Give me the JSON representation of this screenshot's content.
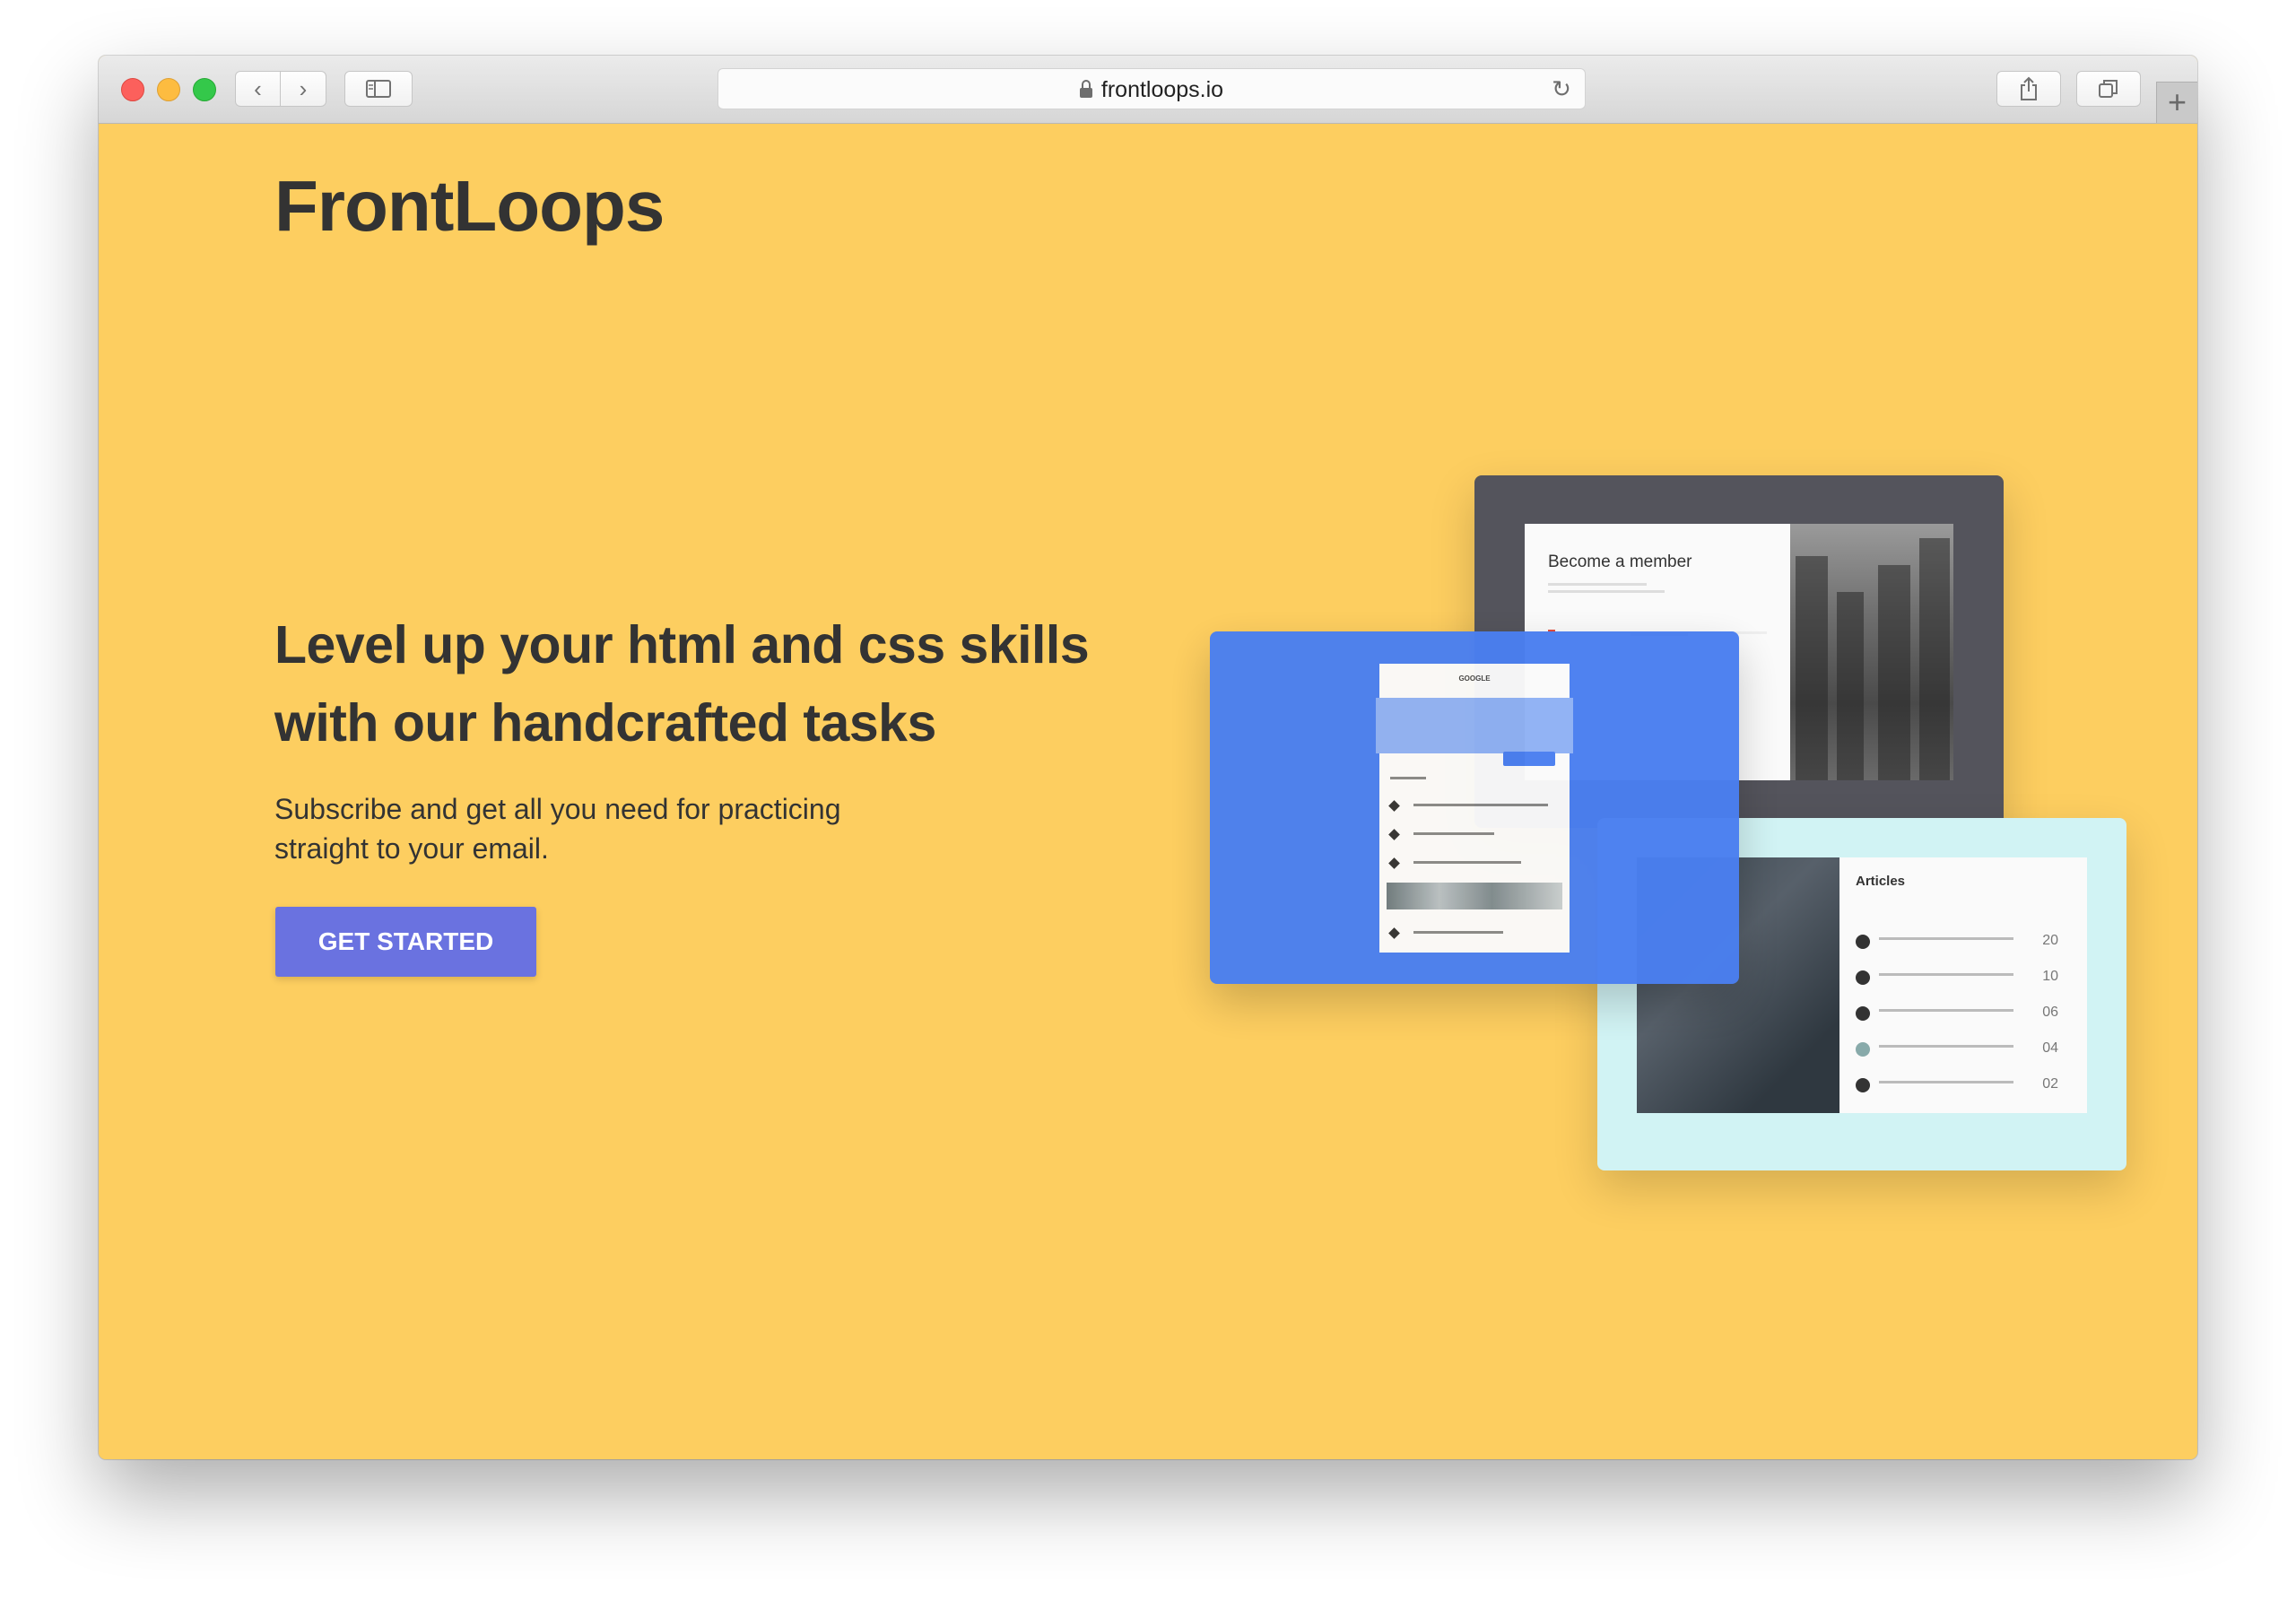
{
  "browser": {
    "url": "frontloops.io",
    "icons": {
      "back": "chevron-left-icon",
      "forward": "chevron-right-icon",
      "sidebar": "sidebar-icon",
      "lock": "lock-icon",
      "reload": "reload-icon",
      "share": "share-icon",
      "tabs": "tabs-icon",
      "new_tab": "plus-icon"
    }
  },
  "page": {
    "logo": "FrontLoops",
    "headline_line1": "Level up your html and css skills",
    "headline_line2": "with our handcrafted tasks",
    "subtext_line1": "Subscribe and get all you need for practicing",
    "subtext_line2": "straight to your email.",
    "cta_label": "GET STARTED",
    "colors": {
      "background": "#fdce60",
      "cta": "#6a72e0",
      "text": "#333333",
      "card_dark": "#54545c",
      "card_blue": "#4a7ff0",
      "card_cyan": "#d1f3f4"
    }
  },
  "previews": {
    "member_title": "Become a member",
    "map_title": "GOOGLE",
    "articles_title": "Articles",
    "article_numbers": [
      "20",
      "10",
      "06",
      "04",
      "02"
    ]
  }
}
